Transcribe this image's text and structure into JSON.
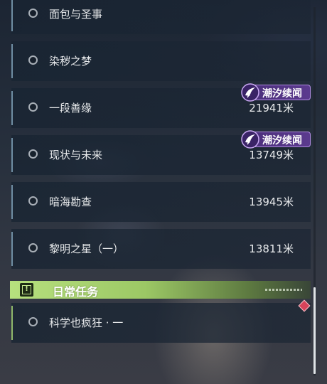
{
  "quests": [
    {
      "name": "面包与圣事",
      "distance": "",
      "tag": ""
    },
    {
      "name": "染秽之梦",
      "distance": "",
      "tag": ""
    },
    {
      "name": "一段善缘",
      "distance": "21941米",
      "tag": "潮汐续闻"
    },
    {
      "name": "现状与未来",
      "distance": "13749米",
      "tag": "潮汐续闻"
    },
    {
      "name": "暗海勘查",
      "distance": "13945米",
      "tag": ""
    },
    {
      "name": "黎明之星（一）",
      "distance": "13811米",
      "tag": ""
    }
  ],
  "daily_section": {
    "title": "日常任务",
    "icon": "exclamation-icon",
    "accent_color": "#b7e07e"
  },
  "daily_quests": [
    {
      "name": "科学也疯狂 · 一",
      "distance": ""
    }
  ],
  "colors": {
    "tag_purple": "#5b3a8e",
    "row_accent": "#6f8ea3",
    "daily_accent": "#8fb86a",
    "tracked_marker": "#d7435a"
  }
}
